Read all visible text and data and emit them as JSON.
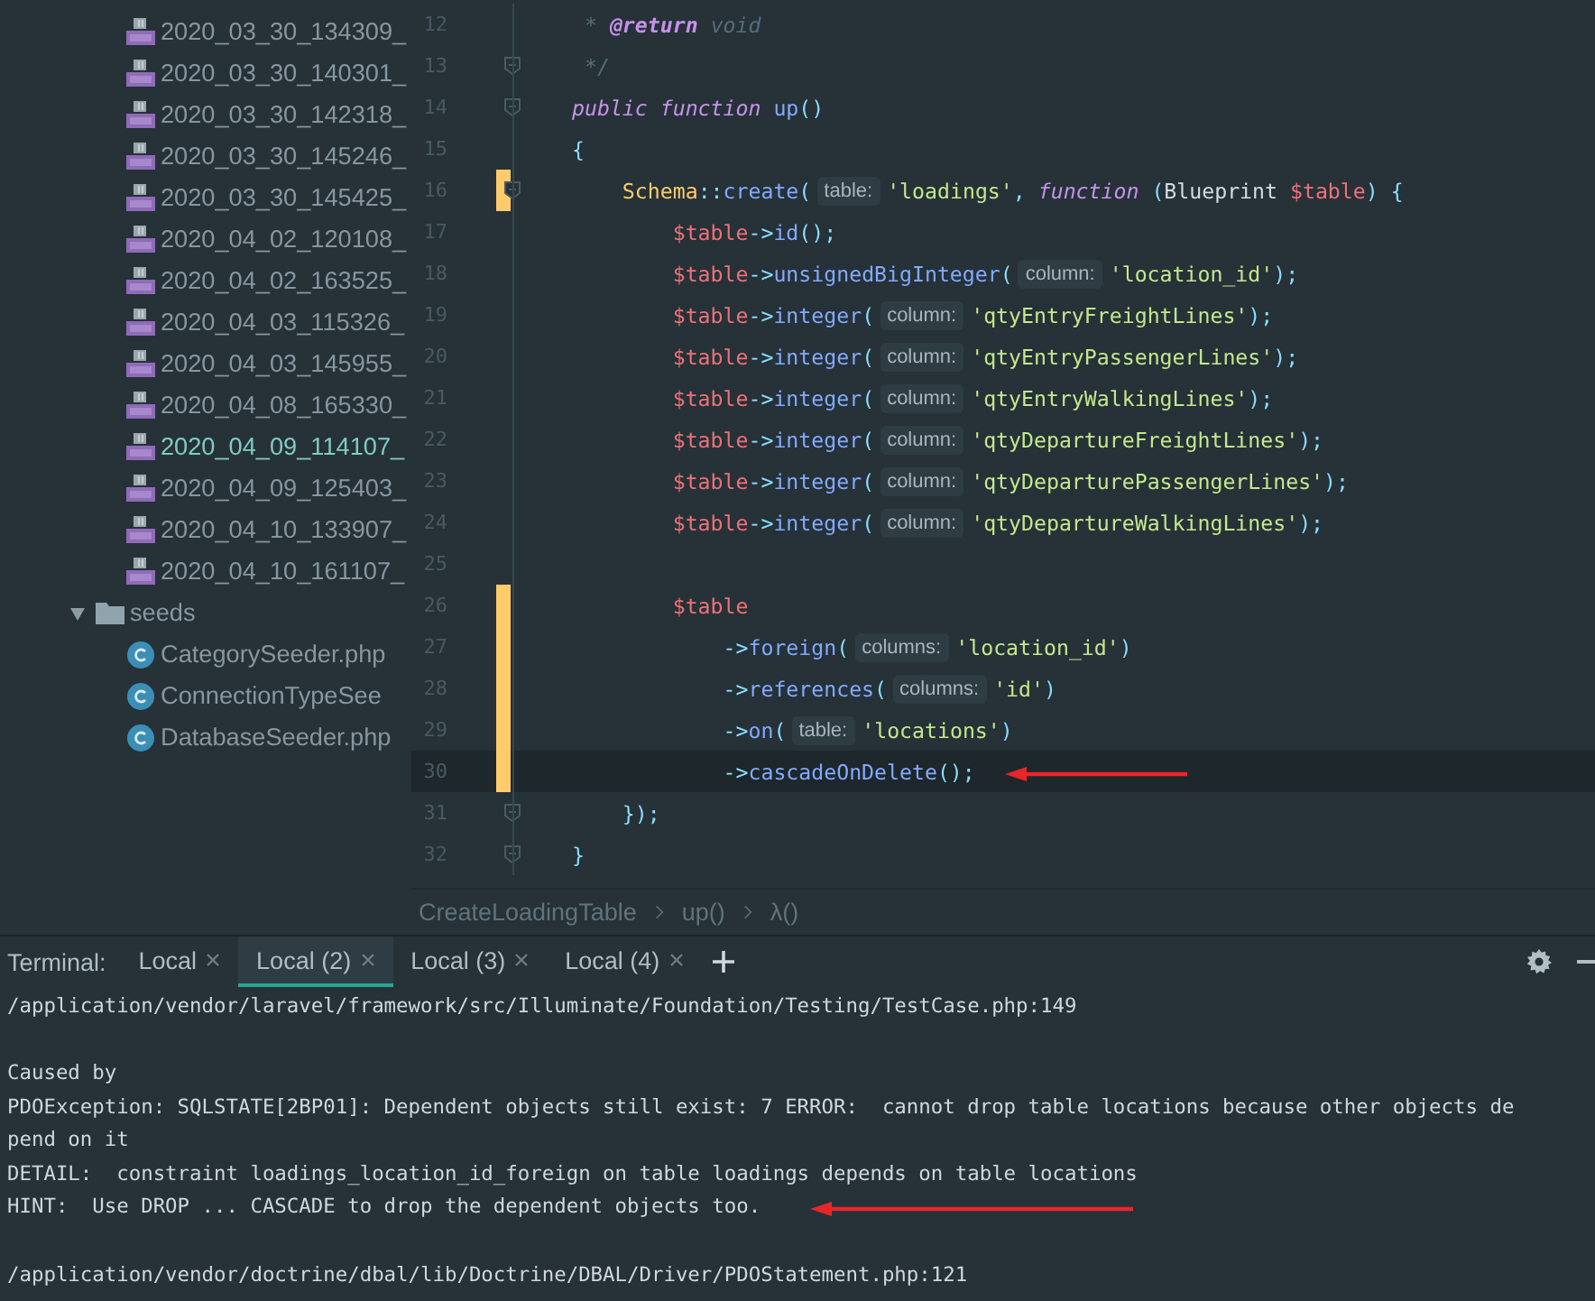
{
  "file_tree": {
    "items": [
      {
        "kind": "php-file",
        "label": "2020_03_30_134309_",
        "highlighted": false
      },
      {
        "kind": "php-file",
        "label": "2020_03_30_140301_",
        "highlighted": false
      },
      {
        "kind": "php-file",
        "label": "2020_03_30_142318_",
        "highlighted": false
      },
      {
        "kind": "php-file",
        "label": "2020_03_30_145246_",
        "highlighted": false
      },
      {
        "kind": "php-file",
        "label": "2020_03_30_145425_",
        "highlighted": false
      },
      {
        "kind": "php-file",
        "label": "2020_04_02_120108_",
        "highlighted": false
      },
      {
        "kind": "php-file",
        "label": "2020_04_02_163525_",
        "highlighted": false
      },
      {
        "kind": "php-file",
        "label": "2020_04_03_115326_",
        "highlighted": false
      },
      {
        "kind": "php-file",
        "label": "2020_04_03_145955_",
        "highlighted": false
      },
      {
        "kind": "php-file",
        "label": "2020_04_08_165330_",
        "highlighted": false
      },
      {
        "kind": "php-file",
        "label": "2020_04_09_114107_",
        "highlighted": true
      },
      {
        "kind": "php-file",
        "label": "2020_04_09_125403_",
        "highlighted": false
      },
      {
        "kind": "php-file",
        "label": "2020_04_10_133907_",
        "highlighted": false
      },
      {
        "kind": "php-file",
        "label": "2020_04_10_161107_",
        "highlighted": false
      },
      {
        "kind": "folder",
        "label": "seeds",
        "highlighted": false,
        "expanded": true,
        "children": [
          {
            "kind": "class-file",
            "label": "CategorySeeder.php",
            "highlighted": false
          },
          {
            "kind": "class-file",
            "label": "ConnectionTypeSee",
            "highlighted": false
          },
          {
            "kind": "class-file",
            "label": "DatabaseSeeder.php",
            "highlighted": false
          }
        ]
      }
    ]
  },
  "editor": {
    "lines": [
      {
        "number": "12",
        "modified": false,
        "current": false,
        "fold": false,
        "arrow": false,
        "tokens": [
          {
            "kind": "comment",
            "text": " * "
          },
          {
            "kind": "doc-tag",
            "text": "@return"
          },
          {
            "kind": "comment",
            "text": " void"
          }
        ]
      },
      {
        "number": "13",
        "modified": false,
        "current": false,
        "fold": true,
        "arrow": false,
        "tokens": [
          {
            "kind": "comment",
            "text": " */"
          }
        ]
      },
      {
        "number": "14",
        "modified": false,
        "current": false,
        "fold": true,
        "arrow": false,
        "tokens": [
          {
            "kind": "keyword",
            "text": "public function "
          },
          {
            "kind": "method",
            "text": "up"
          },
          {
            "kind": "punct",
            "text": "()"
          }
        ]
      },
      {
        "number": "15",
        "modified": false,
        "current": false,
        "fold": false,
        "arrow": false,
        "tokens": [
          {
            "kind": "punct",
            "text": "{"
          }
        ]
      },
      {
        "number": "16",
        "modified": true,
        "current": false,
        "fold": true,
        "arrow": false,
        "tokens": [
          {
            "kind": "class",
            "text": "    Schema"
          },
          {
            "kind": "punct",
            "text": "::"
          },
          {
            "kind": "method",
            "text": "create"
          },
          {
            "kind": "punct",
            "text": "("
          },
          {
            "kind": "hint",
            "text": "table:"
          },
          {
            "kind": "string",
            "text": "'loadings'"
          },
          {
            "kind": "punct",
            "text": ", "
          },
          {
            "kind": "keyword",
            "text": "function"
          },
          {
            "kind": "punct",
            "text": " ("
          },
          {
            "kind": "plain",
            "text": "Blueprint "
          },
          {
            "kind": "var",
            "text": "$table"
          },
          {
            "kind": "punct",
            "text": ") {"
          }
        ]
      },
      {
        "number": "17",
        "modified": false,
        "current": false,
        "fold": false,
        "arrow": false,
        "tokens": [
          {
            "kind": "var",
            "text": "        $table"
          },
          {
            "kind": "punct",
            "text": "->"
          },
          {
            "kind": "method",
            "text": "id"
          },
          {
            "kind": "punct",
            "text": "();"
          }
        ]
      },
      {
        "number": "18",
        "modified": false,
        "current": false,
        "fold": false,
        "arrow": false,
        "tokens": [
          {
            "kind": "var",
            "text": "        $table"
          },
          {
            "kind": "punct",
            "text": "->"
          },
          {
            "kind": "method",
            "text": "unsignedBigInteger"
          },
          {
            "kind": "punct",
            "text": "("
          },
          {
            "kind": "hint",
            "text": "column:"
          },
          {
            "kind": "string",
            "text": "'location_id'"
          },
          {
            "kind": "punct",
            "text": ");"
          }
        ]
      },
      {
        "number": "19",
        "modified": false,
        "current": false,
        "fold": false,
        "arrow": false,
        "tokens": [
          {
            "kind": "var",
            "text": "        $table"
          },
          {
            "kind": "punct",
            "text": "->"
          },
          {
            "kind": "method",
            "text": "integer"
          },
          {
            "kind": "punct",
            "text": "("
          },
          {
            "kind": "hint",
            "text": "column:"
          },
          {
            "kind": "string",
            "text": "'qtyEntryFreightLines'"
          },
          {
            "kind": "punct",
            "text": ");"
          }
        ]
      },
      {
        "number": "20",
        "modified": false,
        "current": false,
        "fold": false,
        "arrow": false,
        "tokens": [
          {
            "kind": "var",
            "text": "        $table"
          },
          {
            "kind": "punct",
            "text": "->"
          },
          {
            "kind": "method",
            "text": "integer"
          },
          {
            "kind": "punct",
            "text": "("
          },
          {
            "kind": "hint",
            "text": "column:"
          },
          {
            "kind": "string",
            "text": "'qtyEntryPassengerLines'"
          },
          {
            "kind": "punct",
            "text": ");"
          }
        ]
      },
      {
        "number": "21",
        "modified": false,
        "current": false,
        "fold": false,
        "arrow": false,
        "tokens": [
          {
            "kind": "var",
            "text": "        $table"
          },
          {
            "kind": "punct",
            "text": "->"
          },
          {
            "kind": "method",
            "text": "integer"
          },
          {
            "kind": "punct",
            "text": "("
          },
          {
            "kind": "hint",
            "text": "column:"
          },
          {
            "kind": "string",
            "text": "'qtyEntryWalkingLines'"
          },
          {
            "kind": "punct",
            "text": ");"
          }
        ]
      },
      {
        "number": "22",
        "modified": false,
        "current": false,
        "fold": false,
        "arrow": false,
        "tokens": [
          {
            "kind": "var",
            "text": "        $table"
          },
          {
            "kind": "punct",
            "text": "->"
          },
          {
            "kind": "method",
            "text": "integer"
          },
          {
            "kind": "punct",
            "text": "("
          },
          {
            "kind": "hint",
            "text": "column:"
          },
          {
            "kind": "string",
            "text": "'qtyDepartureFreightLines'"
          },
          {
            "kind": "punct",
            "text": ");"
          }
        ]
      },
      {
        "number": "23",
        "modified": false,
        "current": false,
        "fold": false,
        "arrow": false,
        "tokens": [
          {
            "kind": "var",
            "text": "        $table"
          },
          {
            "kind": "punct",
            "text": "->"
          },
          {
            "kind": "method",
            "text": "integer"
          },
          {
            "kind": "punct",
            "text": "("
          },
          {
            "kind": "hint",
            "text": "column:"
          },
          {
            "kind": "string",
            "text": "'qtyDeparturePassengerLines'"
          },
          {
            "kind": "punct",
            "text": ");"
          }
        ]
      },
      {
        "number": "24",
        "modified": false,
        "current": false,
        "fold": false,
        "arrow": false,
        "tokens": [
          {
            "kind": "var",
            "text": "        $table"
          },
          {
            "kind": "punct",
            "text": "->"
          },
          {
            "kind": "method",
            "text": "integer"
          },
          {
            "kind": "punct",
            "text": "("
          },
          {
            "kind": "hint",
            "text": "column:"
          },
          {
            "kind": "string",
            "text": "'qtyDepartureWalkingLines'"
          },
          {
            "kind": "punct",
            "text": ");"
          }
        ]
      },
      {
        "number": "25",
        "modified": false,
        "current": false,
        "fold": false,
        "arrow": false
      },
      {
        "number": "26",
        "modified": true,
        "current": false,
        "fold": false,
        "arrow": false,
        "tokens": [
          {
            "kind": "var",
            "text": "        $table"
          }
        ]
      },
      {
        "number": "27",
        "modified": true,
        "current": false,
        "fold": false,
        "arrow": false,
        "tokens": [
          {
            "kind": "punct",
            "text": "            ->"
          },
          {
            "kind": "method",
            "text": "foreign"
          },
          {
            "kind": "punct",
            "text": "("
          },
          {
            "kind": "hint",
            "text": "columns:"
          },
          {
            "kind": "string",
            "text": "'location_id'"
          },
          {
            "kind": "punct",
            "text": ")"
          }
        ]
      },
      {
        "number": "28",
        "modified": true,
        "current": false,
        "fold": false,
        "arrow": false,
        "tokens": [
          {
            "kind": "punct",
            "text": "            ->"
          },
          {
            "kind": "method",
            "text": "references"
          },
          {
            "kind": "punct",
            "text": "("
          },
          {
            "kind": "hint",
            "text": "columns:"
          },
          {
            "kind": "string",
            "text": "'id'"
          },
          {
            "kind": "punct",
            "text": ")"
          }
        ]
      },
      {
        "number": "29",
        "modified": true,
        "current": false,
        "fold": false,
        "arrow": false,
        "tokens": [
          {
            "kind": "punct",
            "text": "            ->"
          },
          {
            "kind": "method",
            "text": "on"
          },
          {
            "kind": "punct",
            "text": "("
          },
          {
            "kind": "hint",
            "text": "table:"
          },
          {
            "kind": "string",
            "text": "'locations'"
          },
          {
            "kind": "punct",
            "text": ")"
          }
        ]
      },
      {
        "number": "30",
        "modified": true,
        "current": true,
        "fold": false,
        "arrow": true,
        "tokens": [
          {
            "kind": "punct",
            "text": "            ->"
          },
          {
            "kind": "method",
            "text": "cascadeOnDelete"
          },
          {
            "kind": "punct",
            "text": "();"
          }
        ]
      },
      {
        "number": "31",
        "modified": false,
        "current": false,
        "fold": true,
        "arrow": false,
        "tokens": [
          {
            "kind": "punct",
            "text": "    });"
          }
        ]
      },
      {
        "number": "32",
        "modified": false,
        "current": false,
        "fold": true,
        "arrow": false,
        "tokens": [
          {
            "kind": "punct",
            "text": "}"
          }
        ]
      }
    ]
  },
  "breadcrumb": [
    "CreateLoadingTable",
    "up()",
    "λ()"
  ],
  "terminal": {
    "label": "Terminal:",
    "tabs": [
      {
        "label": "Local",
        "selected": false
      },
      {
        "label": "Local (2)",
        "selected": true
      },
      {
        "label": "Local (3)",
        "selected": false
      },
      {
        "label": "Local (4)",
        "selected": false
      }
    ],
    "lines": [
      {
        "kind": "text",
        "arrow": false,
        "text": "/application/vendor/laravel/framework/src/Illuminate/Foundation/Testing/TestCase.php:149"
      },
      {
        "kind": "blank",
        "arrow": false
      },
      {
        "kind": "text",
        "arrow": false,
        "text": "Caused by"
      },
      {
        "kind": "text",
        "arrow": false,
        "text": "PDOException: SQLSTATE[2BP01]: Dependent objects still exist: 7 ERROR:  cannot drop table locations because other objects de"
      },
      {
        "kind": "text",
        "arrow": false,
        "text": "pend on it"
      },
      {
        "kind": "text",
        "arrow": false,
        "text": "DETAIL:  constraint loadings_location_id_foreign on table loadings depends on table locations"
      },
      {
        "kind": "text",
        "arrow": true,
        "text": "HINT:  Use DROP ... CASCADE to drop the dependent objects too."
      },
      {
        "kind": "blank",
        "arrow": false
      },
      {
        "kind": "text",
        "arrow": false,
        "text": "/application/vendor/doctrine/dbal/lib/Doctrine/DBAL/Driver/PDOStatement.php:121"
      }
    ]
  }
}
